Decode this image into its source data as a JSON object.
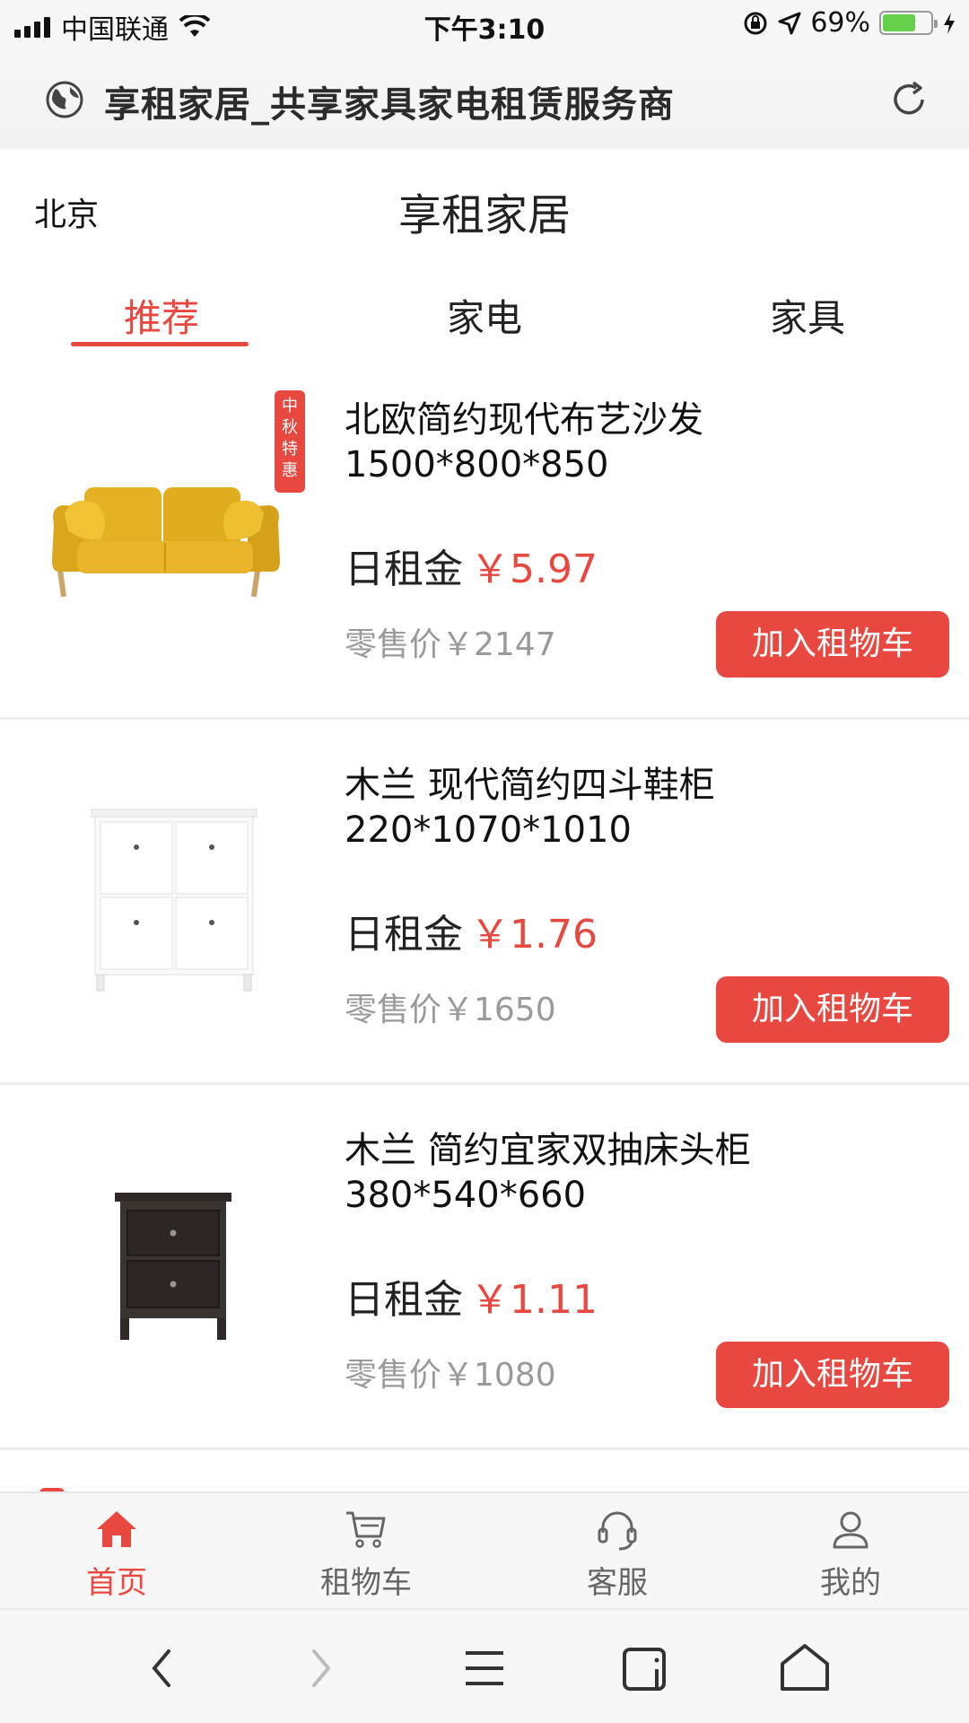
{
  "status_bar": {
    "carrier": "中国联通",
    "time": "下午3:10",
    "battery": "69%",
    "battery_level": 0.69
  },
  "browser": {
    "page_title": "享租家居_共享家具家电租赁服务商"
  },
  "header": {
    "city": "北京",
    "title": "享租家居"
  },
  "tabs": [
    {
      "label": "推荐",
      "active": true
    },
    {
      "label": "家电",
      "active": false
    },
    {
      "label": "家具",
      "active": false
    }
  ],
  "products": [
    {
      "name": "北欧简约现代布艺沙发",
      "size": "1500*800*850",
      "rent_label": "日租金",
      "rent_price": "￥5.97",
      "retail": "零售价￥2147",
      "button": "加入租物车",
      "promo_tag": "中秋特惠",
      "image": "yellow-sofa"
    },
    {
      "name": "木兰 现代简约四斗鞋柜",
      "size": "220*1070*1010",
      "rent_label": "日租金",
      "rent_price": "￥1.76",
      "retail": "零售价￥1650",
      "button": "加入租物车",
      "image": "white-shoe-cabinet"
    },
    {
      "name": "木兰 简约宜家双抽床头柜",
      "size": "380*540*660",
      "rent_label": "日租金",
      "rent_price": "￥1.11",
      "retail": "零售价￥1080",
      "button": "加入租物车",
      "image": "dark-nightstand"
    }
  ],
  "bottom_nav": [
    {
      "label": "首页",
      "icon": "home-icon",
      "active": true
    },
    {
      "label": "租物车",
      "icon": "cart-icon",
      "active": false
    },
    {
      "label": "客服",
      "icon": "headset-icon",
      "active": false
    },
    {
      "label": "我的",
      "icon": "user-icon",
      "active": false
    }
  ],
  "browser_toolbar": [
    "back-icon",
    "forward-icon",
    "menu-icon",
    "tabs-icon",
    "home-icon"
  ],
  "colors": {
    "accent": "#e8483f",
    "muted": "#9a9a9a"
  }
}
